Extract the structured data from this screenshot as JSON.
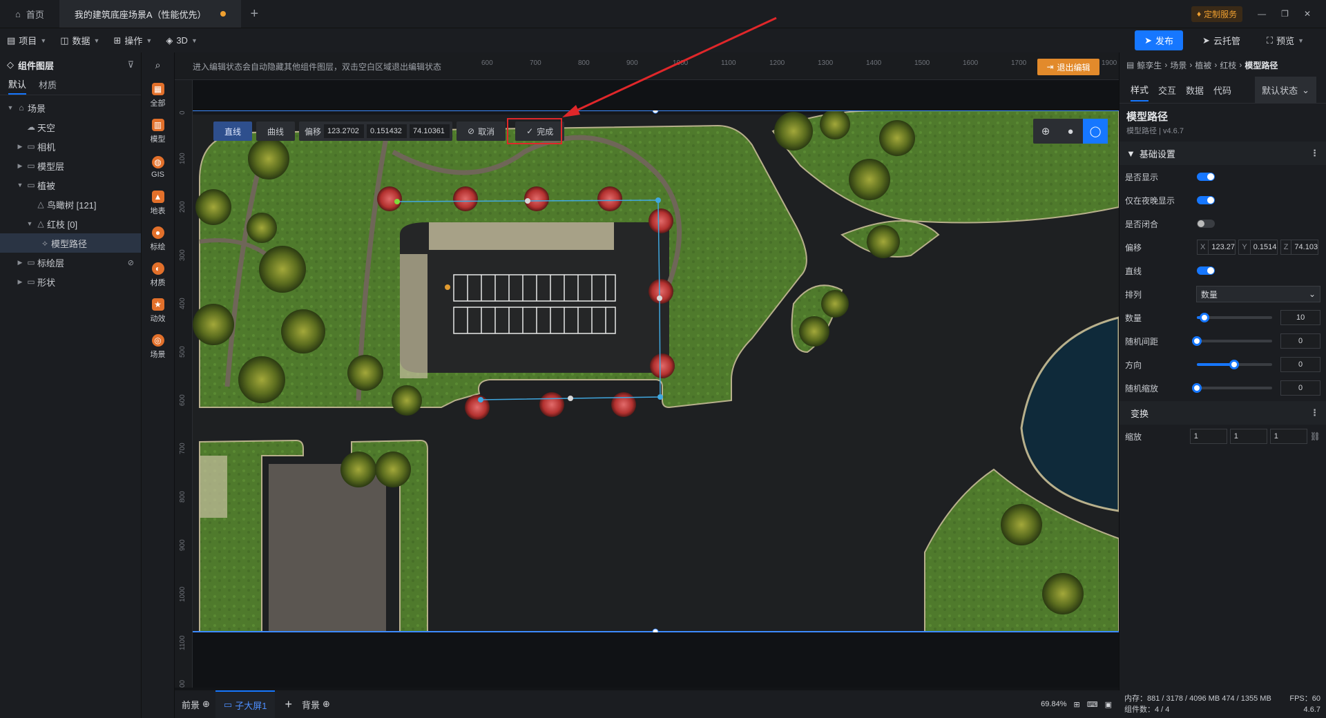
{
  "titlebar": {
    "home_label": "首页",
    "doc_tab": "我的建筑底座场景A（性能优先）",
    "custom_service": "定制服务"
  },
  "menubar": {
    "items": [
      "项目",
      "数据",
      "操作",
      "3D"
    ],
    "publish": "发布",
    "cloud": "云托管",
    "preview": "预览"
  },
  "layers": {
    "title": "组件图层",
    "tabs": [
      "默认",
      "材质"
    ],
    "tree": [
      "场景",
      "天空",
      "相机",
      "模型层",
      "植被",
      "鸟瞰树 [121]",
      "红枝 [0]",
      "模型路径",
      "标绘层",
      "形状"
    ]
  },
  "tools": [
    "全部",
    "模型",
    "GIS",
    "地表",
    "标绘",
    "材质",
    "动效",
    "场景"
  ],
  "canvas": {
    "hint": "进入编辑状态会自动隐藏其他组件图层，双击空白区域退出编辑状态",
    "exit_edit": "退出编辑",
    "ruler_top": [
      "600",
      "700",
      "800",
      "900",
      "1000",
      "1100",
      "1200",
      "1300",
      "1400",
      "1500",
      "1600",
      "1700",
      "1800",
      "1900"
    ],
    "ruler_left": [
      "0",
      "100",
      "200",
      "300",
      "400",
      "500",
      "600",
      "700",
      "800",
      "900",
      "1000",
      "1100",
      "00"
    ],
    "path_toolbar": {
      "straight": "直线",
      "curve": "曲线",
      "offset_label": "偏移",
      "offset_x": "123.2702",
      "offset_y": "0.151432",
      "offset_z": "74.10361",
      "cancel": "取消",
      "done": "完成"
    }
  },
  "bottombar": {
    "front": "前景",
    "screen": "子大屏1",
    "back": "背景",
    "zoom": "69.84%"
  },
  "props": {
    "breadcrumb": [
      "鲸孪生",
      "场景",
      "植被",
      "红枝",
      "模型路径"
    ],
    "tabs": [
      "样式",
      "交互",
      "数据",
      "代码"
    ],
    "state": "默认状态",
    "comp_name": "模型路径",
    "comp_sub": "模型路径 | v4.6.7",
    "section_basic": "基础设置",
    "visible": "是否显示",
    "night_only": "仅在夜晚显示",
    "closed": "是否闭合",
    "offset": "偏移",
    "offset_x": "123.27(",
    "offset_y": "0.1514:",
    "offset_z": "74.103(",
    "straight": "直线",
    "arrange": "排列",
    "arrange_value": "数量",
    "count": "数量",
    "count_value": "10",
    "count_level": 0.1,
    "rand_gap": "随机间距",
    "rand_gap_value": "0",
    "direction": "方向",
    "direction_value": "0",
    "direction_level": 0.5,
    "rand_scale": "随机缩放",
    "rand_scale_value": "0",
    "section_transform": "变换",
    "scale": "缩放",
    "scale_x": "1",
    "scale_y": "1",
    "scale_z": "1"
  },
  "status": {
    "mem": "内存：881 / 3178 / 4096 MB  474 / 1355 MB",
    "fps": "FPS：60",
    "count": "组件数：4 / 4",
    "version": "4.6.7"
  }
}
